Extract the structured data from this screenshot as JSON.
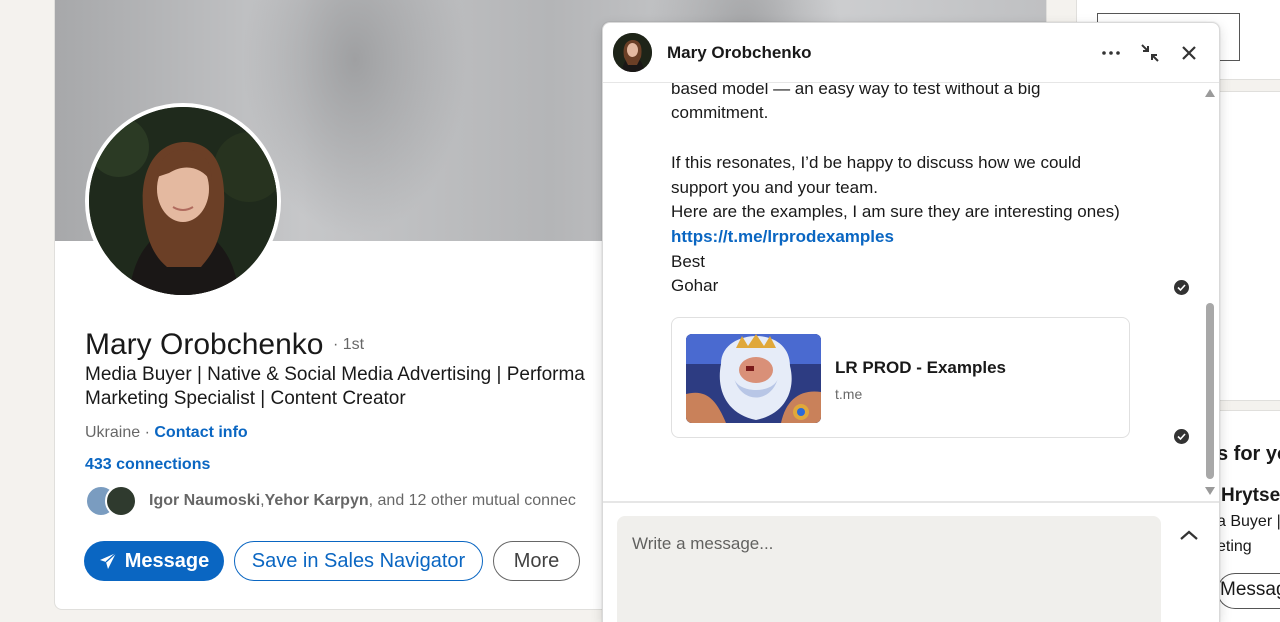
{
  "profile": {
    "name": "Mary Orobchenko",
    "degree": "· 1st",
    "headline_line1": "Media Buyer | Native & Social Media Advertising | Performa",
    "headline_line2": "Marketing Specialist | Content Creator",
    "location": "Ukraine",
    "location_sep": " · ",
    "contact_info": "Contact info",
    "connections": "433 connections",
    "mutual_name1": "Igor Naumoski",
    "mutual_sep": ", ",
    "mutual_name2": "Yehor Karpyn",
    "mutual_rest": ", and 12 other mutual connec",
    "buttons": {
      "message": "Message",
      "sales_navigator": "Save in Sales Navigator",
      "more": "More"
    }
  },
  "right_rail": {
    "title_fragment": "s for yo",
    "person_fragment": "Hrytse",
    "role_fragment1": "a Buyer |",
    "role_fragment2": "eting",
    "button_fragment": "Messag"
  },
  "chat": {
    "contact_name": "Mary Orobchenko",
    "messages": {
      "line1": "based model — an easy way to test without a big",
      "line2": "commitment.",
      "line3": "If this resonates, I’d be happy to discuss how we could",
      "line4": "support you and your team.",
      "line5": "Here are the examples, I am sure they are interesting ones)",
      "link": "https://t.me/lrprodexamples",
      "line6": "Best",
      "line7": "Gohar"
    },
    "link_preview": {
      "title": "LR PROD - Examples",
      "domain": "t.me"
    },
    "compose_placeholder": "Write a message..."
  },
  "colors": {
    "brand_blue": "#0a66c2",
    "page_bg": "#f4f2ee"
  }
}
